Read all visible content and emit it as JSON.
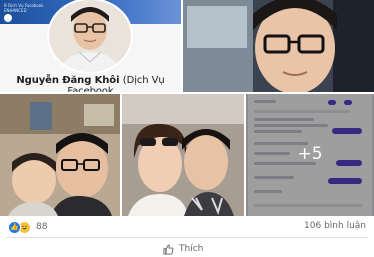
{
  "profile_card": {
    "name": "Nguyễn Đăng Khôi",
    "subtitle": "(Dịch Vụ Facebook",
    "cover_text_1": "B Dịch Vụ Facebook",
    "cover_text_2": "ENHANCED"
  },
  "gallery": {
    "more_count": "+5"
  },
  "post_stats": {
    "reaction_count": "88",
    "comments_label": "106 bình luận"
  },
  "actions": {
    "like_label": "Thích"
  },
  "colors": {
    "like_blue": "#1877f2",
    "haha_yellow": "#f5c33b",
    "muted_text": "#65676b",
    "messenger_purple": "#5c3fd6"
  },
  "icons": [
    "like-icon",
    "haha-icon",
    "thumbs-up-icon"
  ]
}
